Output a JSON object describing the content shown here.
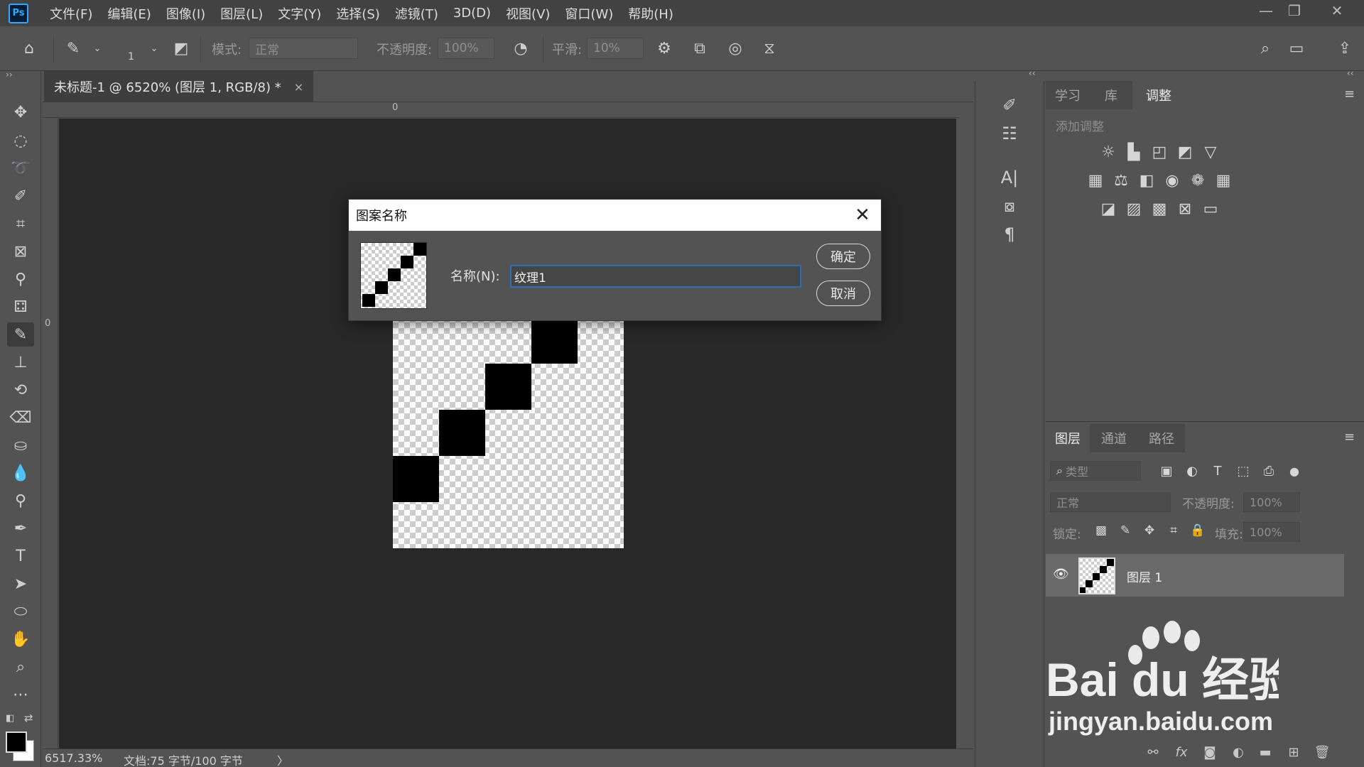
{
  "app": {
    "logo": "Ps"
  },
  "menu": [
    "文件(F)",
    "编辑(E)",
    "图像(I)",
    "图层(L)",
    "文字(Y)",
    "选择(S)",
    "滤镜(T)",
    "3D(D)",
    "视图(V)",
    "窗口(W)",
    "帮助(H)"
  ],
  "window_controls": {
    "minimize": "—",
    "restore": "❐",
    "close": "✕"
  },
  "options": {
    "brush_size": "1",
    "mode_label": "模式:",
    "mode_value": "正常",
    "opacity_label": "不透明度:",
    "opacity_value": "100%",
    "smooth_label": "平滑:",
    "smooth_value": "10%"
  },
  "document": {
    "tab_title": "未标题-1 @ 6520% (图层 1, RGB/8) *",
    "tab_close": "×",
    "ruler_top_zero": "0",
    "ruler_left_zero": "0",
    "zoom": "6517.33%",
    "doc_info": "文档:75 字节/100 字节",
    "status_arrow": "〉"
  },
  "dialog": {
    "title": "图案名称",
    "name_label": "名称(N):",
    "name_value": "纹理1",
    "ok": "确定",
    "cancel": "取消"
  },
  "panels": {
    "top_tabs": [
      "学习",
      "库",
      "调整"
    ],
    "add_adjustment": "添加调整",
    "layer_tabs": [
      "图层",
      "通道",
      "路径"
    ],
    "filter_placeholder": "类型",
    "blend_mode": "正常",
    "opacity_label": "不透明度:",
    "opacity_value": "100%",
    "lock_label": "锁定:",
    "fill_label": "填充:",
    "fill_value": "100%",
    "layer_name": "图层 1"
  },
  "watermark": {
    "brand": "Bai du 经验",
    "url": "jingyan.baidu.com"
  }
}
